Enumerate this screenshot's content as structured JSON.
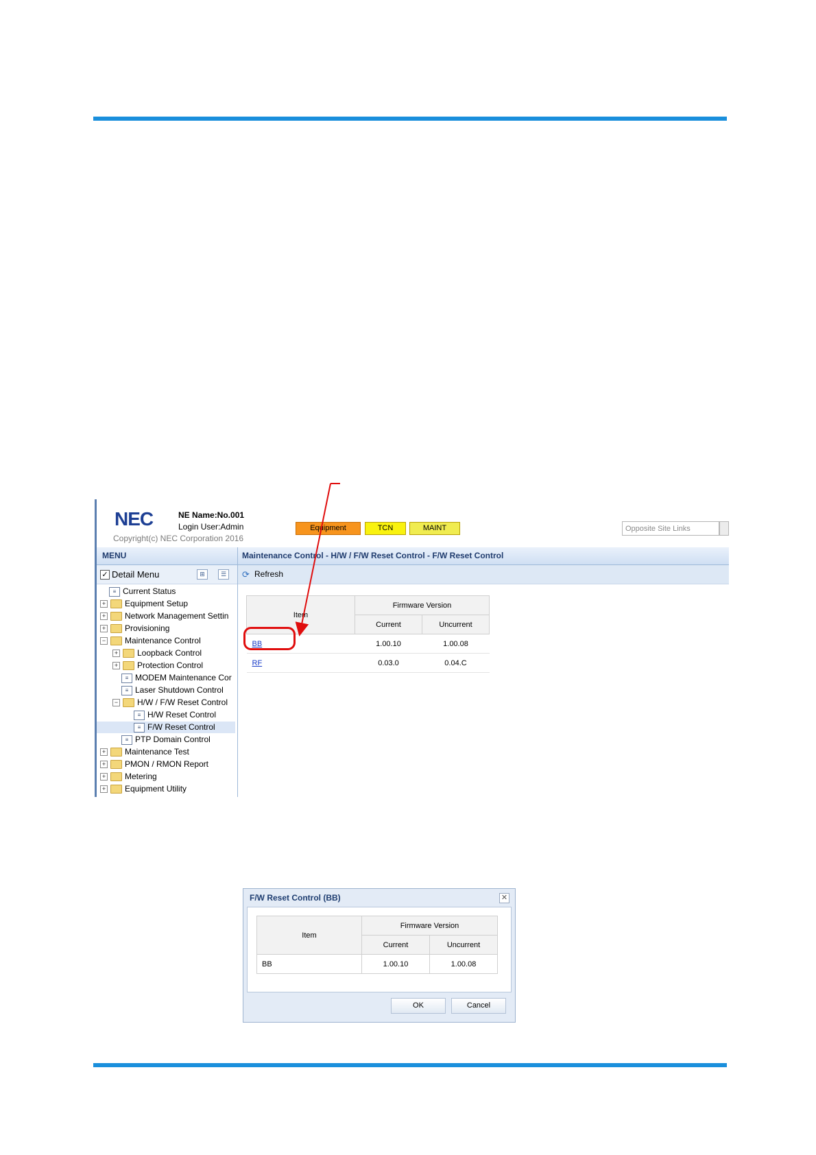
{
  "header": {
    "logo": "NEC",
    "ne_name": "NE Name:No.001",
    "login_user": "Login User:Admin",
    "copyright": "Copyright(c) NEC Corporation 2016",
    "status_tags": [
      "Equipment",
      "TCN",
      "MAINT"
    ],
    "opposite_site_placeholder": "Opposite Site Links"
  },
  "sidebar": {
    "title": "MENU",
    "detail_menu_label": "Detail Menu",
    "detail_menu_checked": true,
    "items": [
      {
        "label": "Current Status"
      },
      {
        "label": "Equipment Setup"
      },
      {
        "label": "Network Management Settin"
      },
      {
        "label": "Provisioning"
      },
      {
        "label": "Maintenance Control"
      },
      {
        "label": "Loopback Control"
      },
      {
        "label": "Protection Control"
      },
      {
        "label": "MODEM Maintenance Cor"
      },
      {
        "label": "Laser Shutdown Control"
      },
      {
        "label": "H/W / F/W Reset Control"
      },
      {
        "label": "H/W Reset Control"
      },
      {
        "label": "F/W Reset Control"
      },
      {
        "label": "PTP Domain Control"
      },
      {
        "label": "Maintenance Test"
      },
      {
        "label": "PMON / RMON Report"
      },
      {
        "label": "Metering"
      },
      {
        "label": "Equipment Utility"
      }
    ]
  },
  "main": {
    "breadcrumb": "Maintenance Control - H/W / F/W Reset Control - F/W Reset Control",
    "refresh_label": "Refresh",
    "table": {
      "col_item": "Item",
      "col_group": "Firmware Version",
      "col_current": "Current",
      "col_uncurrent": "Uncurrent",
      "rows": [
        {
          "item": "BB",
          "current": "1.00.10",
          "uncurrent": "1.00.08"
        },
        {
          "item": "RF",
          "current": "0.03.0",
          "uncurrent": "0.04.C"
        }
      ]
    }
  },
  "dialog": {
    "title": "F/W Reset Control (BB)",
    "table": {
      "col_item": "Item",
      "col_group": "Firmware Version",
      "col_current": "Current",
      "col_uncurrent": "Uncurrent",
      "rows": [
        {
          "item": "BB",
          "current": "1.00.10",
          "uncurrent": "1.00.08"
        }
      ]
    },
    "ok_label": "OK",
    "cancel_label": "Cancel"
  },
  "colors": {
    "rule": "#1a8fdc",
    "highlight": "#e00d0d",
    "equipment_tag": "#f7941d",
    "tcn_tag": "#f9f20f",
    "maint_tag": "#f0ec50"
  }
}
